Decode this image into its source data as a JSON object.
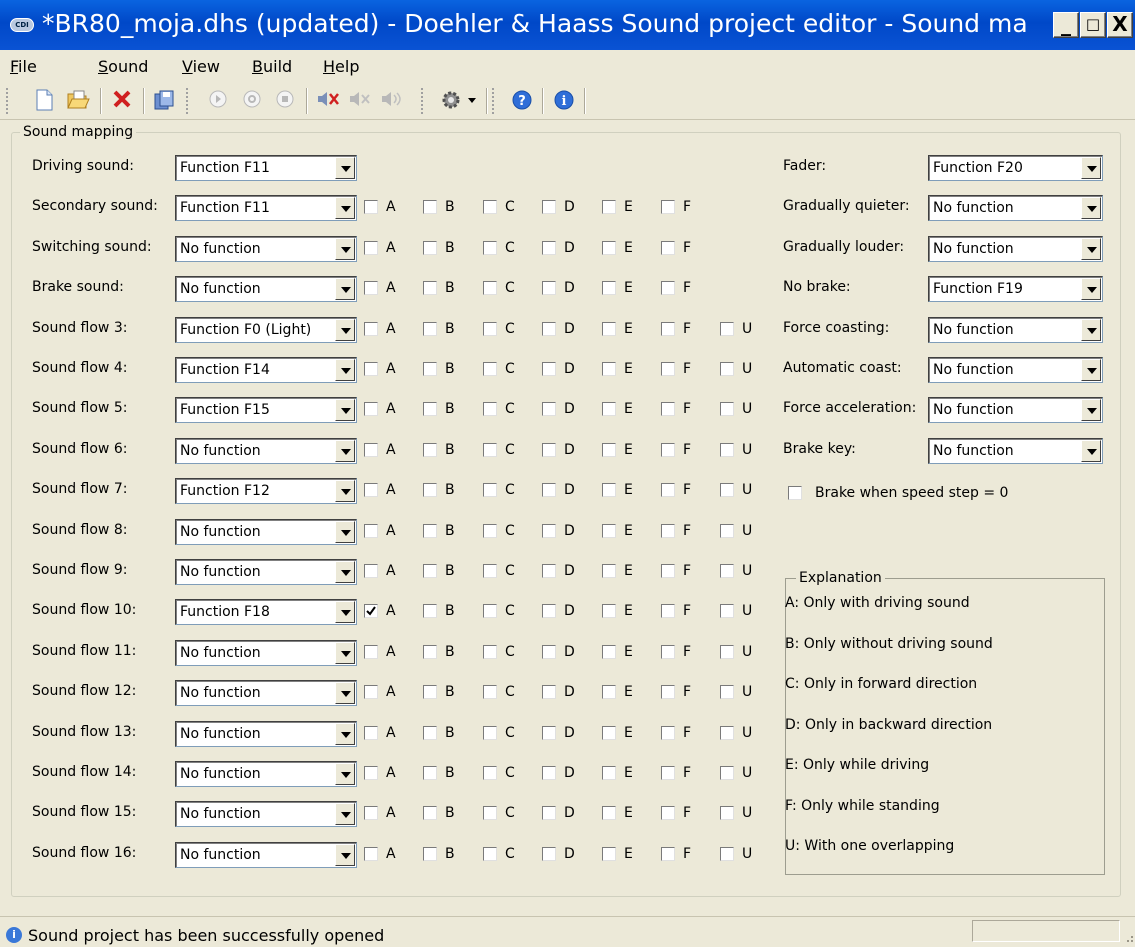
{
  "window": {
    "title": "*BR80_moja.dhs (updated) - Doehler & Haass Sound project editor - Sound ma...",
    "app_icon": "CDI",
    "minimize": "_",
    "maximize": "□",
    "close": "X"
  },
  "menu": [
    {
      "mnemonic": "F",
      "rest": "ile"
    },
    {
      "mnemonic": "S",
      "rest": "ound"
    },
    {
      "mnemonic": "V",
      "rest": "iew"
    },
    {
      "mnemonic": "B",
      "rest": "uild"
    },
    {
      "mnemonic": "H",
      "rest": "elp"
    }
  ],
  "toolbar": {
    "icons": [
      "new-file-icon",
      "open-folder-icon",
      "delete-icon",
      "save-icon",
      "play-icon",
      "stop-icon",
      "record-icon",
      "sound-a-icon",
      "sound-b-icon",
      "sound-c-icon",
      "settings-gear-icon",
      "help-icon",
      "info-icon"
    ]
  },
  "mapping": {
    "group_title": "Sound mapping",
    "option_letters": [
      "A",
      "B",
      "C",
      "D",
      "E",
      "F",
      "U"
    ],
    "rows": [
      {
        "label": "Driving sound:",
        "value": "Function F11"
      },
      {
        "label": "Secondary sound:",
        "value": "Function F11"
      },
      {
        "label": "Switching sound:",
        "value": "No function"
      },
      {
        "label": "Brake sound:",
        "value": "No function"
      },
      {
        "label": "Sound flow 3:",
        "value": "Function F0 (Light)"
      },
      {
        "label": "Sound flow 4:",
        "value": "Function F14"
      },
      {
        "label": "Sound flow 5:",
        "value": "Function F15"
      },
      {
        "label": "Sound flow 6:",
        "value": "No function"
      },
      {
        "label": "Sound flow 7:",
        "value": "Function F12"
      },
      {
        "label": "Sound flow 8:",
        "value": "No function"
      },
      {
        "label": "Sound flow 9:",
        "value": "No function"
      },
      {
        "label": "Sound flow 10:",
        "value": "Function F18"
      },
      {
        "label": "Sound flow 11:",
        "value": "No function"
      },
      {
        "label": "Sound flow 12:",
        "value": "No function"
      },
      {
        "label": "Sound flow 13:",
        "value": "No function"
      },
      {
        "label": "Sound flow 14:",
        "value": "No function"
      },
      {
        "label": "Sound flow 15:",
        "value": "No function"
      },
      {
        "label": "Sound flow 16:",
        "value": "No function"
      }
    ],
    "checked": {
      "11": [
        "A"
      ]
    }
  },
  "right_panel": {
    "rows": [
      {
        "label": "Fader:",
        "value": "Function F20"
      },
      {
        "label": "Gradually quieter:",
        "value": "No function"
      },
      {
        "label": "Gradually louder:",
        "value": "No function"
      },
      {
        "label": "No brake:",
        "value": "Function F19"
      },
      {
        "label": "Force coasting:",
        "value": "No function"
      },
      {
        "label": "Automatic coast:",
        "value": "No function"
      },
      {
        "label": "Force acceleration:",
        "value": "No function"
      },
      {
        "label": "Brake key:",
        "value": "No function"
      }
    ],
    "brake_checkbox_label": "Brake when speed step = 0"
  },
  "explanation": {
    "title": "Explanation",
    "lines": [
      "A: Only with driving sound",
      "B: Only without driving sound",
      "C: Only in forward direction",
      "D: Only in backward direction",
      "E: Only while driving",
      "F: Only while standing",
      "U: With one overlapping"
    ]
  },
  "status": {
    "icon": "i",
    "text": "Sound project has been successfully opened"
  }
}
